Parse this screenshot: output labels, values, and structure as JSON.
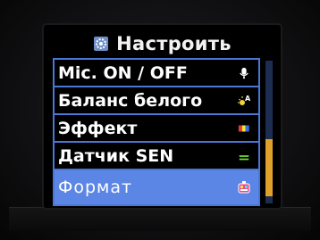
{
  "menu": {
    "title": "Настроить",
    "items": [
      {
        "label": "Mic. ON / OFF",
        "icon": "microphone-icon"
      },
      {
        "label": "Баланс белого",
        "icon": "white-balance-icon"
      },
      {
        "label": "Эффект",
        "icon": "effect-icon"
      },
      {
        "label": "Датчик SEN",
        "icon": "sensor-icon"
      },
      {
        "label": "Формат",
        "icon": "format-icon"
      }
    ],
    "selected_index": 4
  },
  "colors": {
    "accent": "#4a76d6",
    "selected_row": "#5c86e6",
    "scroll_thumb": "#e0a12c"
  }
}
